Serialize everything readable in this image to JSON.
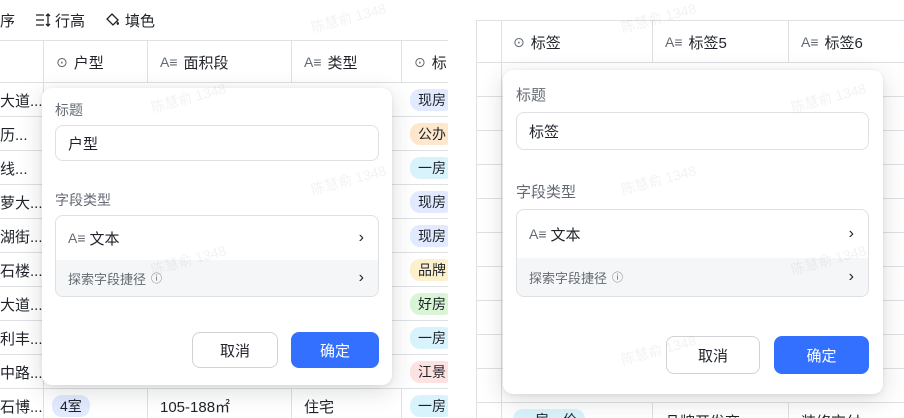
{
  "left": {
    "toolbar": {
      "sort_label": "序",
      "row_height_label": "行高",
      "fill_label": "填色"
    },
    "columns": [
      {
        "icon": "circle-chevron-icon",
        "label": "户型"
      },
      {
        "icon": "text-field-icon",
        "label": "面积段"
      },
      {
        "icon": "text-field-icon",
        "label": "类型"
      },
      {
        "icon": "circle-chevron-icon",
        "label": "标"
      }
    ],
    "rows": [
      {
        "name": "大道...",
        "tag": "现房"
      },
      {
        "name": "历...",
        "tag": "公办"
      },
      {
        "name": "线...",
        "tag": "一房"
      },
      {
        "name": "萝大...",
        "tag": "现房"
      },
      {
        "name": "湖街...",
        "tag": "现房"
      },
      {
        "name": "石楼...",
        "tag": "品牌"
      },
      {
        "name": "大道...",
        "tag": "好房"
      },
      {
        "name": "利丰...",
        "tag": "一房"
      },
      {
        "name": "中路...",
        "tag": "江景"
      },
      {
        "name": "石博...",
        "huxing": "4室",
        "area": "105-188㎡",
        "type": "住宅",
        "tag": "一房"
      }
    ],
    "dialog": {
      "title_label": "标题",
      "title_value": "户型",
      "field_type_label": "字段类型",
      "field_type_value": "文本",
      "explore_label": "探索字段捷径",
      "cancel_label": "取消",
      "ok_label": "确定"
    }
  },
  "right": {
    "columns": [
      {
        "icon": "circle-chevron-icon",
        "label": "标签"
      },
      {
        "icon": "text-field-icon",
        "label": "标签5"
      },
      {
        "icon": "text-field-icon",
        "label": "标签6"
      }
    ],
    "bottom_row": {
      "tag": "一房一价",
      "c2": "品牌开发商",
      "c3": "装修交付"
    },
    "dialog": {
      "title_label": "标题",
      "title_value": "标签",
      "field_type_label": "字段类型",
      "field_type_value": "文本",
      "explore_label": "探索字段捷径",
      "cancel_label": "取消",
      "ok_label": "确定"
    }
  },
  "watermark": "陈慧俞 1348",
  "colors": {
    "accent": "#3370ff",
    "border": "#dee0e3",
    "tag_blue": "#e1eaff",
    "tag_orange": "#fee7cd",
    "tag_cyan": "#d9f3fd",
    "tag_yellow": "#fdf0cd",
    "tag_green": "#d9f5d6",
    "tag_red": "#fde2e2",
    "tag_purple": "#e8e3fd"
  }
}
